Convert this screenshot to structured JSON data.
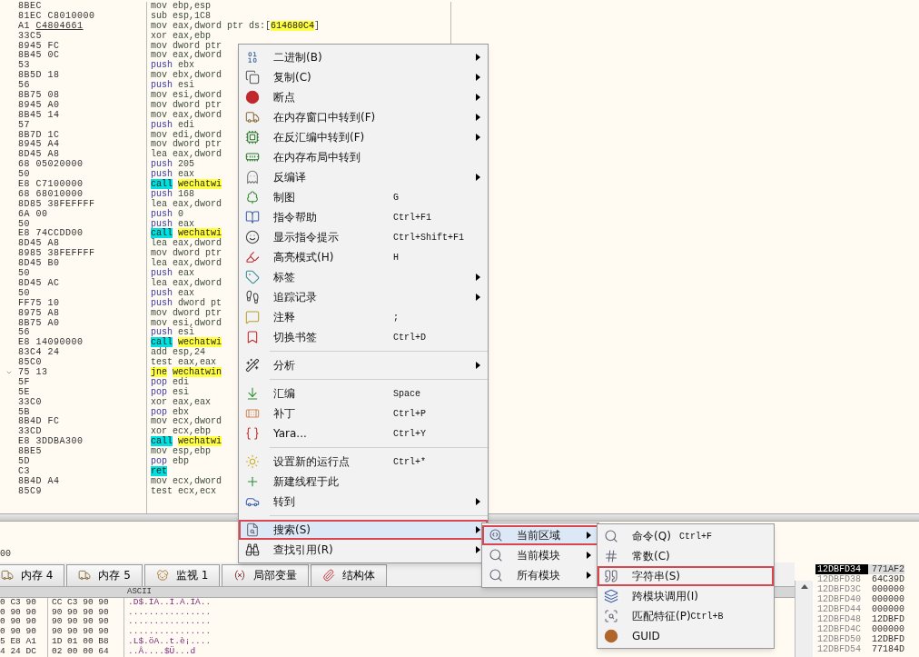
{
  "disassembly": {
    "rows": [
      {
        "bytes": "8BEC",
        "mnemonic": "mov",
        "kind": "plain",
        "operands": [
          {
            "text": "ebp,esp",
            "kind": "plain"
          }
        ]
      },
      {
        "bytes": "81EC C8010000",
        "mnemonic": "sub",
        "kind": "plain",
        "operands": [
          {
            "text": "esp,1C8",
            "kind": "plain"
          }
        ]
      },
      {
        "bytes": "A1",
        "bytes_ref": "C4804661",
        "mnemonic": "mov",
        "kind": "plain",
        "operands": [
          {
            "text": "eax,dword ptr ds:[",
            "kind": "plain"
          },
          {
            "text": "614680C4",
            "kind": "address"
          },
          {
            "text": "]",
            "kind": "plain"
          }
        ]
      },
      {
        "bytes": "33C5",
        "mnemonic": "xor",
        "kind": "plain",
        "operands": [
          {
            "text": "eax,ebp",
            "kind": "plain"
          }
        ]
      },
      {
        "bytes": "8945 FC",
        "mnemonic": "mov",
        "kind": "plain",
        "operands": [
          {
            "text": "dword ptr",
            "kind": "plain"
          }
        ]
      },
      {
        "bytes": "8B45 0C",
        "mnemonic": "mov",
        "kind": "plain",
        "operands": [
          {
            "text": "eax,dword",
            "kind": "plain"
          }
        ]
      },
      {
        "bytes": "53",
        "mnemonic": "push",
        "kind": "stack",
        "operands": [
          {
            "text": "ebx",
            "kind": "plain"
          }
        ]
      },
      {
        "bytes": "8B5D 18",
        "mnemonic": "mov",
        "kind": "plain",
        "operands": [
          {
            "text": "ebx,dword",
            "kind": "plain"
          }
        ]
      },
      {
        "bytes": "56",
        "mnemonic": "push",
        "kind": "stack",
        "operands": [
          {
            "text": "esi",
            "kind": "plain"
          }
        ]
      },
      {
        "bytes": "8B75 08",
        "mnemonic": "mov",
        "kind": "plain",
        "operands": [
          {
            "text": "esi,dword",
            "kind": "plain"
          }
        ]
      },
      {
        "bytes": "8945 A0",
        "mnemonic": "mov",
        "kind": "plain",
        "operands": [
          {
            "text": "dword ptr",
            "kind": "plain"
          }
        ]
      },
      {
        "bytes": "8B45 14",
        "mnemonic": "mov",
        "kind": "plain",
        "operands": [
          {
            "text": "eax,dword",
            "kind": "plain"
          }
        ]
      },
      {
        "bytes": "57",
        "mnemonic": "push",
        "kind": "stack",
        "operands": [
          {
            "text": "edi",
            "kind": "plain"
          }
        ]
      },
      {
        "bytes": "8B7D 1C",
        "mnemonic": "mov",
        "kind": "plain",
        "operands": [
          {
            "text": "edi,dword",
            "kind": "plain"
          }
        ]
      },
      {
        "bytes": "8945 A4",
        "mnemonic": "mov",
        "kind": "plain",
        "operands": [
          {
            "text": "dword ptr",
            "kind": "plain"
          }
        ]
      },
      {
        "bytes": "8D45 A8",
        "mnemonic": "lea",
        "kind": "plain",
        "operands": [
          {
            "text": "eax,dword",
            "kind": "plain"
          }
        ]
      },
      {
        "bytes": "68 05020000",
        "mnemonic": "push",
        "kind": "stack",
        "operands": [
          {
            "text": "205",
            "kind": "plain"
          }
        ]
      },
      {
        "bytes": "50",
        "mnemonic": "push",
        "kind": "stack",
        "operands": [
          {
            "text": "eax",
            "kind": "plain"
          }
        ]
      },
      {
        "bytes": "E8 C7100000",
        "mnemonic": "call",
        "kind": "call",
        "operands": [
          {
            "text": "wechatwi",
            "kind": "address"
          }
        ]
      },
      {
        "bytes": "68 68010000",
        "mnemonic": "push",
        "kind": "stack",
        "operands": [
          {
            "text": "168",
            "kind": "plain"
          }
        ]
      },
      {
        "bytes": "8D85 38FEFFFF",
        "mnemonic": "lea",
        "kind": "plain",
        "operands": [
          {
            "text": "eax,dword",
            "kind": "plain"
          }
        ]
      },
      {
        "bytes": "6A 00",
        "mnemonic": "push",
        "kind": "stack",
        "operands": [
          {
            "text": "0",
            "kind": "plain"
          }
        ]
      },
      {
        "bytes": "50",
        "mnemonic": "push",
        "kind": "stack",
        "operands": [
          {
            "text": "eax",
            "kind": "plain"
          }
        ]
      },
      {
        "bytes": "E8 74CCDD00",
        "mnemonic": "call",
        "kind": "call",
        "operands": [
          {
            "text": "wechatwi",
            "kind": "address"
          }
        ]
      },
      {
        "bytes": "8D45 A8",
        "mnemonic": "lea",
        "kind": "plain",
        "operands": [
          {
            "text": "eax,dword",
            "kind": "plain"
          }
        ]
      },
      {
        "bytes": "8985 38FEFFFF",
        "mnemonic": "mov",
        "kind": "plain",
        "operands": [
          {
            "text": "dword ptr",
            "kind": "plain"
          }
        ]
      },
      {
        "bytes": "8D45 B0",
        "mnemonic": "lea",
        "kind": "plain",
        "operands": [
          {
            "text": "eax,dword",
            "kind": "plain"
          }
        ]
      },
      {
        "bytes": "50",
        "mnemonic": "push",
        "kind": "stack",
        "operands": [
          {
            "text": "eax",
            "kind": "plain"
          }
        ]
      },
      {
        "bytes": "8D45 AC",
        "mnemonic": "lea",
        "kind": "plain",
        "operands": [
          {
            "text": "eax,dword",
            "kind": "plain"
          }
        ]
      },
      {
        "bytes": "50",
        "mnemonic": "push",
        "kind": "stack",
        "operands": [
          {
            "text": "eax",
            "kind": "plain"
          }
        ]
      },
      {
        "bytes": "FF75 10",
        "mnemonic": "push",
        "kind": "stack",
        "operands": [
          {
            "text": "dword pt",
            "kind": "plain"
          }
        ]
      },
      {
        "bytes": "8975 A8",
        "mnemonic": "mov",
        "kind": "plain",
        "operands": [
          {
            "text": "dword ptr",
            "kind": "plain"
          }
        ]
      },
      {
        "bytes": "8B75 A0",
        "mnemonic": "mov",
        "kind": "plain",
        "operands": [
          {
            "text": "esi,dword",
            "kind": "plain"
          }
        ]
      },
      {
        "bytes": "56",
        "mnemonic": "push",
        "kind": "stack",
        "operands": [
          {
            "text": "esi",
            "kind": "plain"
          }
        ]
      },
      {
        "bytes": "E8 14090000",
        "mnemonic": "call",
        "kind": "call",
        "operands": [
          {
            "text": "wechatwi",
            "kind": "address"
          }
        ]
      },
      {
        "bytes": "83C4 24",
        "mnemonic": "add",
        "kind": "plain",
        "operands": [
          {
            "text": "esp,24",
            "kind": "plain"
          }
        ]
      },
      {
        "bytes": "85C0",
        "mnemonic": "test",
        "kind": "plain",
        "operands": [
          {
            "text": "eax,eax",
            "kind": "plain"
          }
        ]
      },
      {
        "bytes": "75 13",
        "jump_marker": true,
        "mnemonic": "jne",
        "kind": "jump",
        "operands": [
          {
            "text": "wechatwin",
            "kind": "address"
          }
        ]
      },
      {
        "bytes": "5F",
        "mnemonic": "pop",
        "kind": "stack",
        "operands": [
          {
            "text": "edi",
            "kind": "plain"
          }
        ]
      },
      {
        "bytes": "5E",
        "mnemonic": "pop",
        "kind": "stack",
        "operands": [
          {
            "text": "esi",
            "kind": "plain"
          }
        ]
      },
      {
        "bytes": "33C0",
        "mnemonic": "xor",
        "kind": "plain",
        "operands": [
          {
            "text": "eax,eax",
            "kind": "plain"
          }
        ]
      },
      {
        "bytes": "5B",
        "mnemonic": "pop",
        "kind": "stack",
        "operands": [
          {
            "text": "ebx",
            "kind": "plain"
          }
        ]
      },
      {
        "bytes": "8B4D FC",
        "mnemonic": "mov",
        "kind": "plain",
        "operands": [
          {
            "text": "ecx,dword",
            "kind": "plain"
          }
        ]
      },
      {
        "bytes": "33CD",
        "mnemonic": "xor",
        "kind": "plain",
        "operands": [
          {
            "text": "ecx,ebp",
            "kind": "plain"
          }
        ]
      },
      {
        "bytes": "E8 3DDBA300",
        "mnemonic": "call",
        "kind": "call",
        "operands": [
          {
            "text": "wechatwi",
            "kind": "address"
          }
        ]
      },
      {
        "bytes": "8BE5",
        "mnemonic": "mov",
        "kind": "plain",
        "operands": [
          {
            "text": "esp,ebp",
            "kind": "plain"
          }
        ]
      },
      {
        "bytes": "5D",
        "mnemonic": "pop",
        "kind": "stack",
        "operands": [
          {
            "text": "ebp",
            "kind": "plain"
          }
        ]
      },
      {
        "bytes": "C3",
        "mnemonic": "ret",
        "kind": "ret",
        "operands": []
      },
      {
        "bytes": "8B4D A4",
        "mnemonic": "mov",
        "kind": "plain",
        "operands": [
          {
            "text": "ecx,dword",
            "kind": "plain"
          }
        ]
      },
      {
        "bytes": "85C9",
        "mnemonic": "test",
        "kind": "plain",
        "operands": [
          {
            "text": "ecx,ecx",
            "kind": "plain"
          }
        ]
      }
    ]
  },
  "info_text": "00",
  "tabs": [
    {
      "label": "内存 4",
      "kind": "memory",
      "selected": false
    },
    {
      "label": "内存 5",
      "kind": "memory",
      "selected": false
    },
    {
      "label": "监视 1",
      "kind": "watch",
      "selected": false
    },
    {
      "label": "局部变量",
      "kind": "variable",
      "selected": false
    },
    {
      "label": "结构体",
      "kind": "struct",
      "selected": false
    }
  ],
  "dump": {
    "ascii_header": "ASCII",
    "rows": [
      {
        "hex_1": "0 C3 90",
        "hex_2": "CC C3 90 90",
        "ascii": ".D$.ÌÀ..Ì.À.ÌÀ.."
      },
      {
        "hex_1": "0 90 90",
        "hex_2": "90 90 90 90",
        "ascii": "................"
      },
      {
        "hex_1": "0 90 90",
        "hex_2": "90 90 90 90",
        "ascii": "................"
      },
      {
        "hex_1": "0 90 90",
        "hex_2": "90 90 90 90",
        "ascii": "................"
      },
      {
        "hex_1": "5 E8 A1",
        "hex_2": "1D 01 00 B8",
        "ascii": ".L$.öA..t.è¡...."
      },
      {
        "hex_1": "4 24 DC",
        "hex_2": "02 00 00 64",
        "ascii": "..Â....$Ü...d"
      }
    ]
  },
  "stack": {
    "rows": [
      {
        "address": "12DBFD34",
        "value": "771AF2",
        "selected": true
      },
      {
        "address": "12DBFD38",
        "value": "64C39D",
        "selected": false
      },
      {
        "address": "12DBFD3C",
        "value": "000000",
        "selected": false
      },
      {
        "address": "12DBFD40",
        "value": "000000",
        "selected": false
      },
      {
        "address": "12DBFD44",
        "value": "000000",
        "selected": false
      },
      {
        "address": "12DBFD48",
        "value": "12DBFD",
        "selected": false
      },
      {
        "address": "12DBFD4C",
        "value": "000000",
        "selected": false
      },
      {
        "address": "12DBFD50",
        "value": "12DBFD",
        "selected": false
      },
      {
        "address": "12DBFD54",
        "value": "77184D",
        "selected": false
      }
    ]
  },
  "context_menu": {
    "items": [
      {
        "label": "二进制(B)",
        "kind": "binary",
        "has_submenu": true,
        "separator_before": false,
        "selected": false,
        "annotated": false
      },
      {
        "label": "复制(C)",
        "kind": "copy",
        "has_submenu": true,
        "separator_before": false,
        "selected": false,
        "annotated": false
      },
      {
        "label": "断点",
        "kind": "breakpoint",
        "has_submenu": true,
        "separator_before": false,
        "selected": false,
        "annotated": false
      },
      {
        "label": "在内存窗口中转到(F)",
        "kind": "memory",
        "has_submenu": true,
        "separator_before": false,
        "selected": false,
        "annotated": false
      },
      {
        "label": "在反汇编中转到(F)",
        "kind": "cpu",
        "has_submenu": true,
        "separator_before": false,
        "selected": false,
        "annotated": false
      },
      {
        "label": "在内存布局中转到",
        "kind": "memmap",
        "has_submenu": false,
        "separator_before": false,
        "selected": false,
        "annotated": false
      },
      {
        "label": "反编译",
        "kind": "ghost",
        "has_submenu": true,
        "separator_before": false,
        "selected": false,
        "annotated": false
      },
      {
        "label": "制图",
        "kind": "tree",
        "shortcut": "G",
        "has_submenu": false,
        "separator_before": false,
        "selected": false,
        "annotated": false
      },
      {
        "label": "指令帮助",
        "kind": "help",
        "shortcut": "Ctrl+F1",
        "has_submenu": false,
        "separator_before": false,
        "selected": false,
        "annotated": false
      },
      {
        "label": "显示指令提示",
        "kind": "face",
        "shortcut": "Ctrl+Shift+F1",
        "has_submenu": false,
        "separator_before": false,
        "selected": false,
        "annotated": false
      },
      {
        "label": "高亮模式(H)",
        "kind": "highlight",
        "shortcut": "H",
        "has_submenu": false,
        "separator_before": false,
        "selected": false,
        "annotated": false
      },
      {
        "label": "标签",
        "kind": "tag",
        "has_submenu": true,
        "separator_before": false,
        "selected": false,
        "annotated": false
      },
      {
        "label": "追踪记录",
        "kind": "trace",
        "has_submenu": true,
        "separator_before": false,
        "selected": false,
        "annotated": false
      },
      {
        "label": "注释",
        "kind": "comment",
        "shortcut": ";",
        "has_submenu": false,
        "separator_before": false,
        "selected": false,
        "annotated": false
      },
      {
        "label": "切换书签",
        "kind": "bookmark",
        "shortcut": "Ctrl+D",
        "has_submenu": false,
        "separator_before": false,
        "selected": false,
        "annotated": false
      },
      {
        "label": "分析",
        "kind": "wand",
        "has_submenu": true,
        "separator_before": true,
        "selected": false,
        "annotated": false
      },
      {
        "label": "汇编",
        "kind": "assemble",
        "shortcut": "Space",
        "has_submenu": false,
        "separator_before": true,
        "selected": false,
        "annotated": false
      },
      {
        "label": "补丁",
        "kind": "patch",
        "shortcut": "Ctrl+P",
        "has_submenu": false,
        "separator_before": false,
        "selected": false,
        "annotated": false
      },
      {
        "label": "Yara...",
        "kind": "braces",
        "shortcut": "Ctrl+Y",
        "has_submenu": false,
        "separator_before": false,
        "selected": false,
        "annotated": false
      },
      {
        "label": "设置新的运行点",
        "kind": "origin",
        "shortcut": "Ctrl+*",
        "has_submenu": false,
        "separator_before": true,
        "selected": false,
        "annotated": false
      },
      {
        "label": "新建线程于此",
        "kind": "thread",
        "has_submenu": false,
        "separator_before": false,
        "selected": false,
        "annotated": false
      },
      {
        "label": "转到",
        "kind": "car",
        "has_submenu": true,
        "separator_before": false,
        "selected": false,
        "annotated": false
      },
      {
        "label": "搜索(S)",
        "kind": "search_doc",
        "has_submenu": true,
        "separator_before": true,
        "selected": true,
        "annotated": true
      },
      {
        "label": "查找引用(R)",
        "kind": "binoculars",
        "has_submenu": true,
        "separator_before": false,
        "selected": false,
        "annotated": false
      }
    ]
  },
  "search_submenu": {
    "items": [
      {
        "label": "当前区域",
        "kind": "region",
        "has_submenu": true,
        "selected": true,
        "annotated": true
      },
      {
        "label": "当前模块",
        "kind": "module",
        "has_submenu": true,
        "selected": false,
        "annotated": false
      },
      {
        "label": "所有模块",
        "kind": "all",
        "has_submenu": true,
        "selected": false,
        "annotated": false
      }
    ]
  },
  "region_submenu": {
    "items": [
      {
        "label": "命令(Q)",
        "kind": "command",
        "shortcut": "Ctrl+F",
        "selected": false,
        "annotated": false
      },
      {
        "label": "常数(C)",
        "kind": "constant",
        "selected": false,
        "annotated": false
      },
      {
        "label": "字符串(S)",
        "kind": "string",
        "selected": false,
        "annotated": true
      },
      {
        "label": "跨模块调用(I)",
        "kind": "intermodular",
        "selected": false,
        "annotated": false
      },
      {
        "label": "匹配特征(P)",
        "kind": "pattern",
        "shortcut": "Ctrl+B",
        "selected": false,
        "annotated": false
      },
      {
        "label": "GUID",
        "kind": "guid",
        "selected": false,
        "annotated": false
      }
    ]
  }
}
